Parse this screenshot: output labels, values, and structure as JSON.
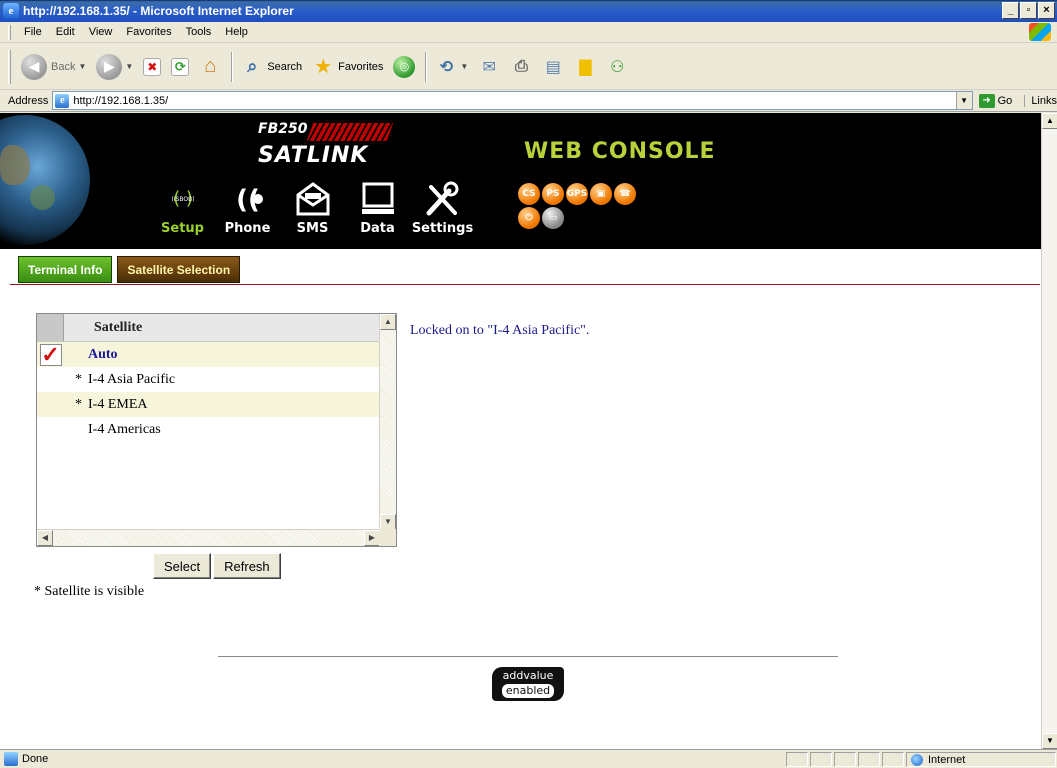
{
  "window": {
    "title": "http://192.168.1.35/ - Microsoft Internet Explorer"
  },
  "menu": {
    "file": "File",
    "edit": "Edit",
    "view": "View",
    "favorites": "Favorites",
    "tools": "Tools",
    "help": "Help"
  },
  "toolbar": {
    "back": "Back",
    "search": "Search",
    "favorites": "Favorites"
  },
  "address": {
    "label": "Address",
    "url": "http://192.168.1.35/",
    "go": "Go",
    "links": "Links"
  },
  "banner": {
    "model": "FB250",
    "brand": "SATLINK",
    "console": "WEB CONSOLE",
    "nav": [
      {
        "label": "Setup",
        "icon": "setup-icon"
      },
      {
        "label": "Phone",
        "icon": "phone-icon"
      },
      {
        "label": "SMS",
        "icon": "sms-envelope-icon"
      },
      {
        "label": "Data",
        "icon": "data-computer-icon"
      },
      {
        "label": "Settings",
        "icon": "settings-tools-icon"
      }
    ],
    "status_icons": [
      "CS",
      "PS",
      "GPS",
      "",
      "",
      "",
      ""
    ]
  },
  "tabs": {
    "terminal_info": "Terminal Info",
    "satellite_selection": "Satellite Selection"
  },
  "satellite_list": {
    "header": "Satellite",
    "rows": [
      {
        "name": "Auto",
        "visible_mark": "",
        "checked": true
      },
      {
        "name": "I-4 Asia Pacific",
        "visible_mark": "*",
        "checked": false
      },
      {
        "name": "I-4 EMEA",
        "visible_mark": "*",
        "checked": false
      },
      {
        "name": "I-4 Americas",
        "visible_mark": "",
        "checked": false
      }
    ]
  },
  "buttons": {
    "select": "Select",
    "refresh": "Refresh"
  },
  "legend": "* Satellite is visible",
  "status_message": "Locked on to \"I-4 Asia Pacific\".",
  "footer": {
    "logo_top": "addvalue",
    "logo_bottom": "enabled"
  },
  "statusbar": {
    "left": "Done",
    "zone": "Internet"
  },
  "colors": {
    "title_blue": "#2b5ec9",
    "tab_green": "#4ea11b",
    "tab_brown": "#5a3a0a",
    "console_green": "#b9d23a",
    "accent_orange": "#f07800",
    "link_blue": "#1a1a8a"
  }
}
